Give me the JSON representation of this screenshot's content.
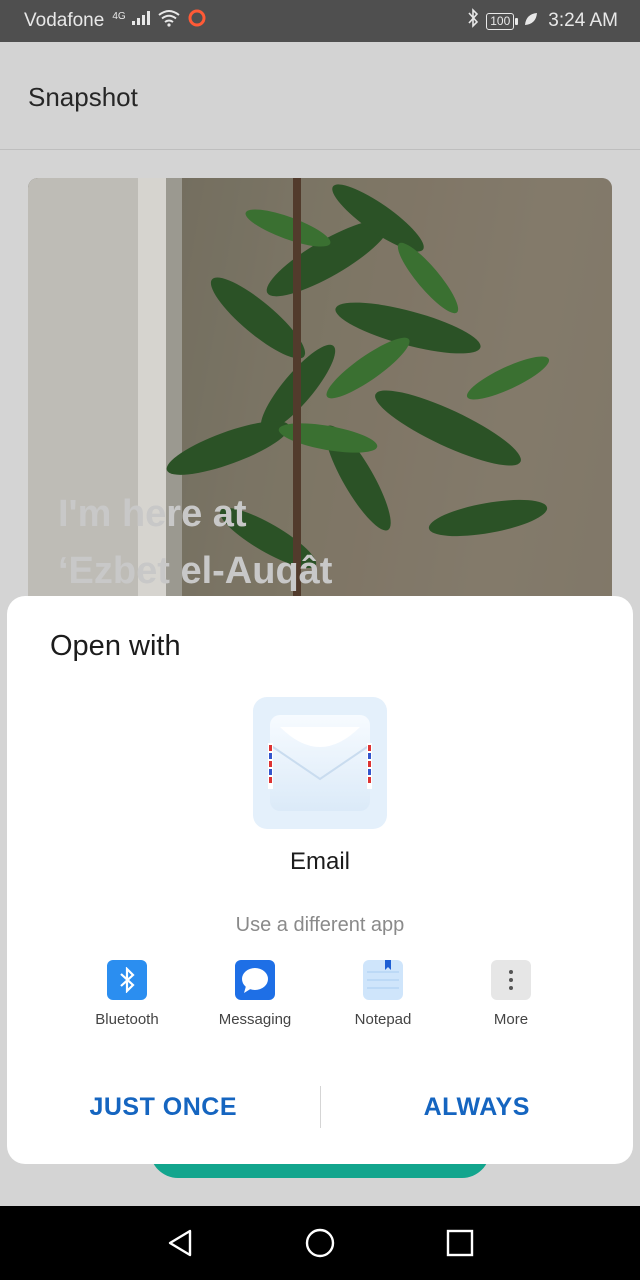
{
  "status_bar": {
    "carrier": "Vodafone",
    "network": "4G",
    "battery": "100",
    "time": "3:24 AM"
  },
  "app_bar": {
    "title": "Snapshot"
  },
  "photo": {
    "caption_line1": "I'm here at",
    "caption_line2": "‘Ezbet el-Auqât"
  },
  "dialog": {
    "title": "Open with",
    "main_app": {
      "label": "Email",
      "icon": "email-icon"
    },
    "different_app_label": "Use a different app",
    "apps": [
      {
        "label": "Bluetooth",
        "icon": "bluetooth-icon",
        "color": "#2b8ef0"
      },
      {
        "label": "Messaging",
        "icon": "messaging-icon",
        "color": "#1e6fe6"
      },
      {
        "label": "Notepad",
        "icon": "notepad-icon",
        "color": "#cfe5fb"
      },
      {
        "label": "More",
        "icon": "more-icon",
        "color": "#e6e6e6"
      }
    ],
    "buttons": {
      "just_once": "JUST ONCE",
      "always": "ALWAYS"
    }
  },
  "colors": {
    "accent": "#1565c0",
    "teal": "#14b39a"
  }
}
